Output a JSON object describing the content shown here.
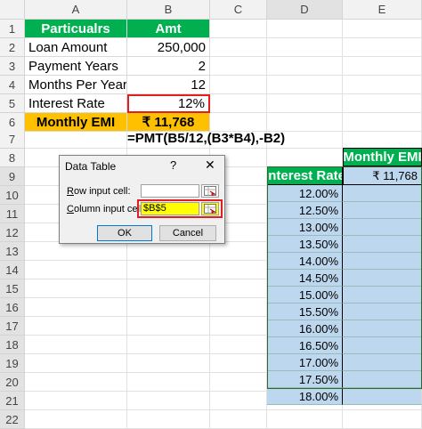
{
  "columns": [
    "A",
    "B",
    "C",
    "D",
    "E"
  ],
  "rows": [
    "1",
    "2",
    "3",
    "4",
    "5",
    "6",
    "7",
    "8",
    "9",
    "10",
    "11",
    "12",
    "13",
    "14",
    "15",
    "16",
    "17",
    "18",
    "19",
    "20",
    "21",
    "22"
  ],
  "table": {
    "header": [
      "Particualrs",
      "Amt"
    ],
    "rows": [
      [
        "Loan Amount",
        "250,000"
      ],
      [
        "Payment Years",
        "2"
      ],
      [
        "Months Per Year",
        "12"
      ],
      [
        "Interest Rate",
        "12%"
      ]
    ],
    "emi_label": "Monthly EMI",
    "emi_value": "₹ 11,768"
  },
  "formula_text": "=PMT(B5/12,(B3*B4),-B2)",
  "data_table": {
    "col_header": "Monthly EMI",
    "rate_header": "Interest Rate",
    "header_value": "₹ 11,768",
    "rates": [
      "12.00%",
      "12.50%",
      "13.00%",
      "13.50%",
      "14.00%",
      "14.50%",
      "15.00%",
      "15.50%",
      "16.00%",
      "16.50%",
      "17.00%",
      "17.50%",
      "18.00%"
    ]
  },
  "dialog": {
    "title": "Data Table",
    "help": "?",
    "close": "✕",
    "row_label_u": "R",
    "row_label_rest": "ow input cell:",
    "row_value": "",
    "col_label_u": "C",
    "col_label_rest": "olumn input cell:",
    "col_value": "$B$5",
    "ok": "OK",
    "cancel": "Cancel"
  },
  "colors": {
    "green": "#00b050",
    "orange": "#ffc000",
    "blue": "#bdd7ee",
    "highlight_red": "#e02020",
    "input_yellow": "#ffff00"
  }
}
